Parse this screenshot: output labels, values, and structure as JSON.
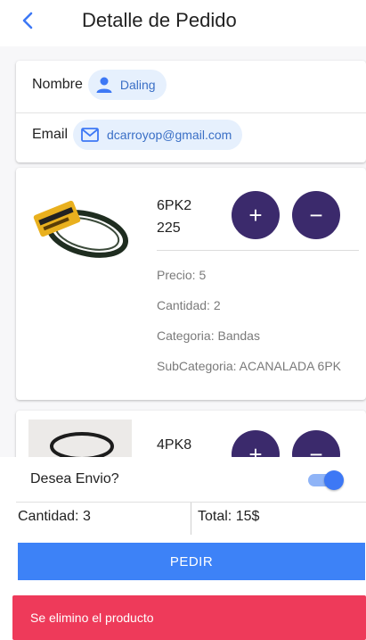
{
  "header": {
    "back_icon": "chevron-left-icon",
    "title": "Detalle de Pedido"
  },
  "user": {
    "name_label": "Nombre",
    "name_icon": "person-icon",
    "name_value": "Daling",
    "email_label": "Email",
    "email_icon": "mail-icon",
    "email_value": "dcarroyop@gmail.com"
  },
  "products": [
    {
      "image_icon": "belt-product-image",
      "name": "6PK2 225",
      "add_label": "+",
      "remove_label": "−",
      "precio": "Precio: 5",
      "cantidad": "Cantidad: 2",
      "categoria": "Categoria: Bandas",
      "subcategoria": "SubCategoria: ACANALADA 6PK"
    },
    {
      "image_icon": "belt-product-image",
      "name": "4PK8",
      "add_label": "+",
      "remove_label": "−"
    }
  ],
  "footer": {
    "envio_label": "Desea Envio?",
    "envio_enabled": true,
    "cantidad": "Cantidad: 3",
    "total": "Total: 15$",
    "pedir_label": "PEDIR"
  },
  "toast": {
    "message": "Se elimino el producto"
  },
  "colors": {
    "accent": "#3d82f7",
    "round_button": "#3b2a6c",
    "chip_bg": "#e6f0fd",
    "toast_bg": "#ee3a5a"
  }
}
